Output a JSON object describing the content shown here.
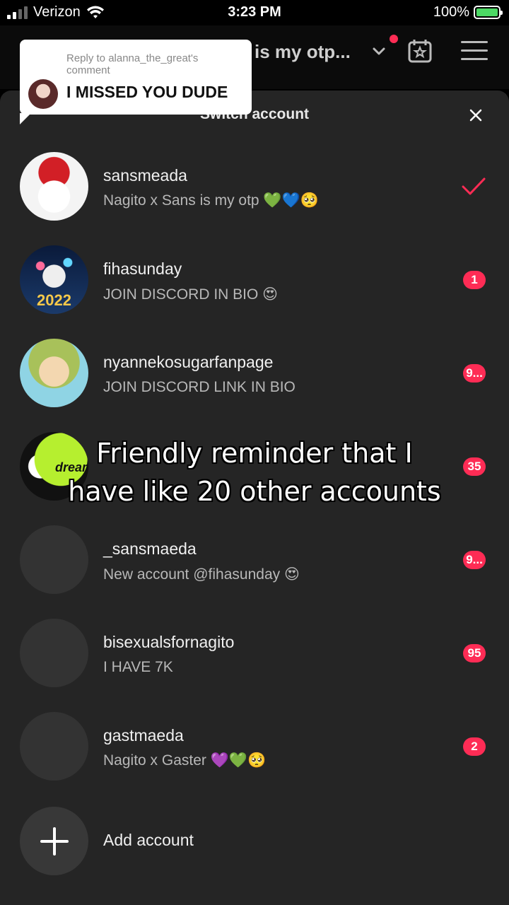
{
  "status_bar": {
    "carrier": "Verizon",
    "time": "3:23 PM",
    "battery": "100%"
  },
  "header": {
    "title_fragment": "is my otp..."
  },
  "comment_bubble": {
    "reply_to": "Reply to alanna_the_great's comment",
    "text": "I MISSED YOU DUDE"
  },
  "sheet": {
    "title": "Switch account"
  },
  "accounts": [
    {
      "username": "sansmeada",
      "bio": "Nagito x Sans is my otp 💚💙🥺",
      "badge": "",
      "selected": true
    },
    {
      "username": "fihasunday",
      "bio": "JOIN DISCORD IN BIO 😍",
      "badge": "1",
      "year_overlay": "2022"
    },
    {
      "username": "nyannekosugarfanpage",
      "bio": "JOIN DISCORD LINK IN BIO",
      "badge": "9..."
    },
    {
      "username": "",
      "bio": "",
      "badge": "35",
      "avatar_text": "dream"
    },
    {
      "username": "_sansmaeda",
      "bio": "New account @fihasunday 😍",
      "badge": "9..."
    },
    {
      "username": "bisexualsfornagito",
      "bio": "I HAVE 7K",
      "badge": "95"
    },
    {
      "username": "gastmaeda",
      "bio": "Nagito x Gaster 💜💚🥺",
      "badge": "2"
    }
  ],
  "add_account": {
    "label": "Add account"
  },
  "caption": {
    "line1": "Friendly reminder that I",
    "line2": "have like 20 other accounts"
  },
  "colors": {
    "accent": "#fe2c55",
    "sheet_bg": "#252525"
  }
}
